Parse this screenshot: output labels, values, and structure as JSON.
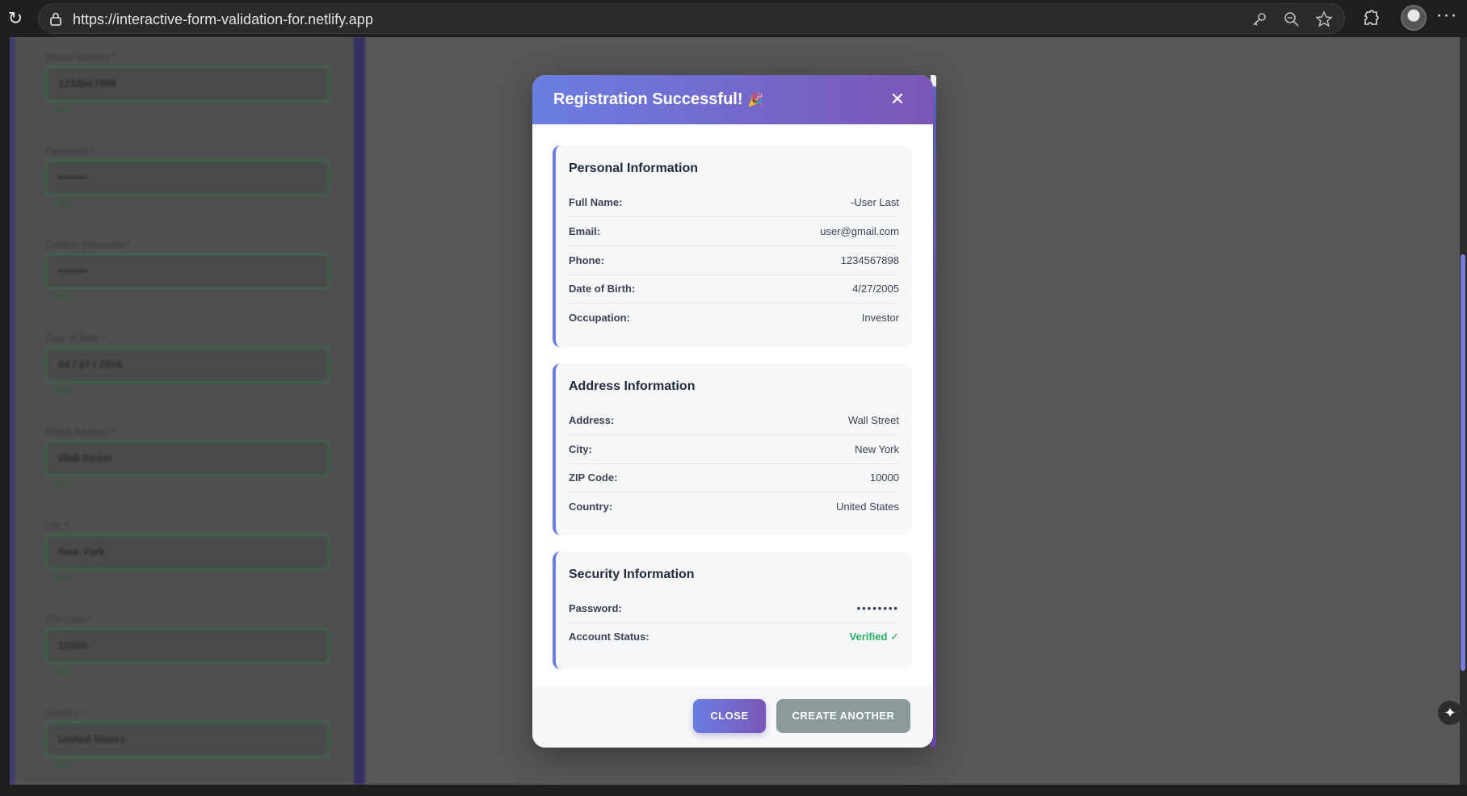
{
  "browser": {
    "url": "https://interactive-form-validation-for.netlify.app"
  },
  "background_form": {
    "fields": [
      {
        "label": "Phone Number *",
        "value": "1234567898",
        "valid": "Valid"
      },
      {
        "label": "Password *",
        "value": "••••••••",
        "valid": "Valid"
      },
      {
        "label": "Confirm Password *",
        "value": "••••••••",
        "valid": "Valid"
      },
      {
        "label": "Date of Birth *",
        "value": "04 / 27 / 2005",
        "valid": "Valid"
      },
      {
        "label": "Street Address *",
        "value": "Wall Street",
        "valid": "Valid"
      },
      {
        "label": "City *",
        "value": "New York",
        "valid": "Valid"
      },
      {
        "label": "ZIP Code *",
        "value": "10000",
        "valid": "Valid"
      },
      {
        "label": "Country *",
        "value": "United States",
        "valid": "Valid"
      }
    ]
  },
  "modal": {
    "title": "Registration Successful!",
    "title_emoji": "🎉",
    "close_symbol": "✕",
    "sections": [
      {
        "title": "Personal Information",
        "rows": [
          {
            "label": "Full Name:",
            "value": "-User Last"
          },
          {
            "label": "Email:",
            "value": "user@gmail.com"
          },
          {
            "label": "Phone:",
            "value": "1234567898"
          },
          {
            "label": "Date of Birth:",
            "value": "4/27/2005"
          },
          {
            "label": "Occupation:",
            "value": "Investor"
          }
        ]
      },
      {
        "title": "Address Information",
        "rows": [
          {
            "label": "Address:",
            "value": "Wall Street"
          },
          {
            "label": "City:",
            "value": "New York"
          },
          {
            "label": "ZIP Code:",
            "value": "10000"
          },
          {
            "label": "Country:",
            "value": "United States"
          }
        ]
      },
      {
        "title": "Security Information",
        "rows": [
          {
            "label": "Password:",
            "value": "••••••••"
          },
          {
            "label": "Account Status:",
            "value": "Verified ✓"
          }
        ]
      }
    ],
    "buttons": {
      "close": "CLOSE",
      "create_another": "CREATE ANOTHER"
    }
  },
  "colors": {
    "accent_start": "#6a7ee2",
    "accent_end": "#7b56b6",
    "verified": "#27ae60",
    "secondary_button": "#8d9a9b"
  }
}
